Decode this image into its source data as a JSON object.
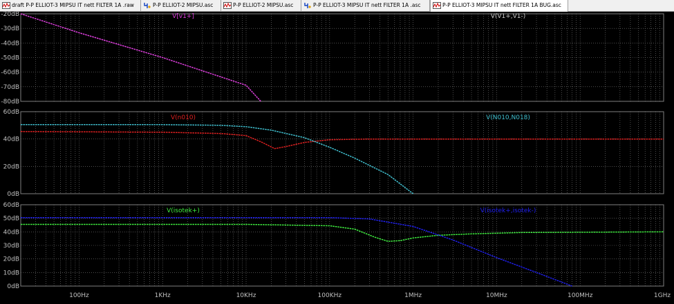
{
  "tabs": [
    {
      "label": "draft P-P ELLIOT-3 MIPSU IT nett FILTER 1A .raw",
      "icon": "waveform-icon",
      "active": false
    },
    {
      "label": "P-P ELLIOT-2 MIPSU.asc",
      "icon": "schematic-icon",
      "active": false
    },
    {
      "label": "P-P ELLIOT-2 MIPSU.asc",
      "icon": "waveform-icon",
      "active": false
    },
    {
      "label": "P-P ELLIOT-3 MIPSU IT nett FILTER 1A .asc",
      "icon": "schematic-icon",
      "active": false
    },
    {
      "label": "P-P ELLIOT-3 MIPSU IT nett FILTER 1A BUG.asc",
      "icon": "waveform-icon",
      "active": true
    }
  ],
  "colors": {
    "background": "#000000",
    "grid": "#808080",
    "axis_text": "#c0c0c0",
    "magenta": "#e040e0",
    "gray_trace": "#c8c8c8",
    "red": "#e02020",
    "cyan": "#40c0d0",
    "green": "#40f040",
    "blue": "#2020f0"
  },
  "chart_data": {
    "type": "line",
    "x_scale": "log",
    "x_unit": "Hz",
    "x_range": [
      20,
      1000000000
    ],
    "x_ticks": [
      {
        "value": 100,
        "label": "100Hz"
      },
      {
        "value": 1000,
        "label": "1KHz"
      },
      {
        "value": 10000,
        "label": "10KHz"
      },
      {
        "value": 100000,
        "label": "100KHz"
      },
      {
        "value": 1000000,
        "label": "1MHz"
      },
      {
        "value": 10000000,
        "label": "10MHz"
      },
      {
        "value": 100000000,
        "label": "100MHz"
      },
      {
        "value": 1000000000,
        "label": "1GHz"
      }
    ],
    "panes": [
      {
        "y_unit": "dB",
        "y_range": [
          -80,
          -20
        ],
        "y_ticks": [
          {
            "value": -20,
            "label": "-20dB"
          },
          {
            "value": -30,
            "label": "-30dB"
          },
          {
            "value": -40,
            "label": "-40dB"
          },
          {
            "value": -50,
            "label": "-50dB"
          },
          {
            "value": -60,
            "label": "-60dB"
          },
          {
            "value": -70,
            "label": "-70dB"
          },
          {
            "value": -80,
            "label": "-80dB"
          }
        ],
        "series": [
          {
            "name": "V[v1+]",
            "color": "#e040e0",
            "label_pos": "center",
            "points": [
              [
                20,
                -20
              ],
              [
                100,
                -33
              ],
              [
                1000,
                -50
              ],
              [
                10000,
                -69
              ],
              [
                15000,
                -80
              ]
            ]
          },
          {
            "name": "V(V1+,V1-)",
            "color": "#c8c8c8",
            "label_pos": "right",
            "points": []
          }
        ]
      },
      {
        "y_unit": "dB",
        "y_range": [
          0,
          60
        ],
        "y_ticks": [
          {
            "value": 60,
            "label": "60dB"
          },
          {
            "value": 40,
            "label": "40dB"
          },
          {
            "value": 20,
            "label": "20dB"
          },
          {
            "value": 0,
            "label": "0dB"
          }
        ],
        "series": [
          {
            "name": "V(n010)",
            "color": "#e02020",
            "label_pos": "center",
            "points": [
              [
                20,
                45.5
              ],
              [
                1000,
                45
              ],
              [
                5000,
                44
              ],
              [
                10000,
                42.5
              ],
              [
                15000,
                38
              ],
              [
                22000,
                33
              ],
              [
                30000,
                34.5
              ],
              [
                50000,
                37.5
              ],
              [
                100000,
                39.5
              ],
              [
                300000,
                40
              ],
              [
                1000000000,
                40
              ]
            ]
          },
          {
            "name": "V(N010,N018)",
            "color": "#40c0d0",
            "label_pos": "right",
            "points": [
              [
                20,
                50.5
              ],
              [
                1000,
                50.5
              ],
              [
                5000,
                50
              ],
              [
                10000,
                49
              ],
              [
                20000,
                46.5
              ],
              [
                50000,
                41
              ],
              [
                100000,
                34
              ],
              [
                200000,
                26
              ],
              [
                500000,
                14
              ],
              [
                1000000,
                0
              ]
            ]
          }
        ]
      },
      {
        "y_unit": "dB",
        "y_range": [
          0,
          60
        ],
        "y_ticks": [
          {
            "value": 60,
            "label": "60dB"
          },
          {
            "value": 50,
            "label": "50dB"
          },
          {
            "value": 40,
            "label": "40dB"
          },
          {
            "value": 30,
            "label": "30dB"
          },
          {
            "value": 20,
            "label": "20dB"
          },
          {
            "value": 10,
            "label": "10dB"
          },
          {
            "value": 0,
            "label": "0dB"
          }
        ],
        "series": [
          {
            "name": "V(isotek+)",
            "color": "#40f040",
            "label_pos": "center",
            "points": [
              [
                20,
                45.5
              ],
              [
                10000,
                45.5
              ],
              [
                100000,
                44.5
              ],
              [
                200000,
                42
              ],
              [
                350000,
                36
              ],
              [
                500000,
                33
              ],
              [
                700000,
                33.5
              ],
              [
                1000000,
                35.5
              ],
              [
                2000000,
                37.5
              ],
              [
                5000000,
                38.5
              ],
              [
                20000000,
                39.5
              ],
              [
                1000000000,
                40
              ]
            ]
          },
          {
            "name": "V(isotek+,isotek-)",
            "color": "#2020f0",
            "label_pos": "right",
            "points": [
              [
                20,
                50.5
              ],
              [
                100000,
                50.5
              ],
              [
                300000,
                49.5
              ],
              [
                1000000,
                44
              ],
              [
                3000000,
                34
              ],
              [
                10000000,
                21
              ],
              [
                30000000,
                10
              ],
              [
                80000000,
                0
              ]
            ]
          }
        ]
      }
    ]
  }
}
